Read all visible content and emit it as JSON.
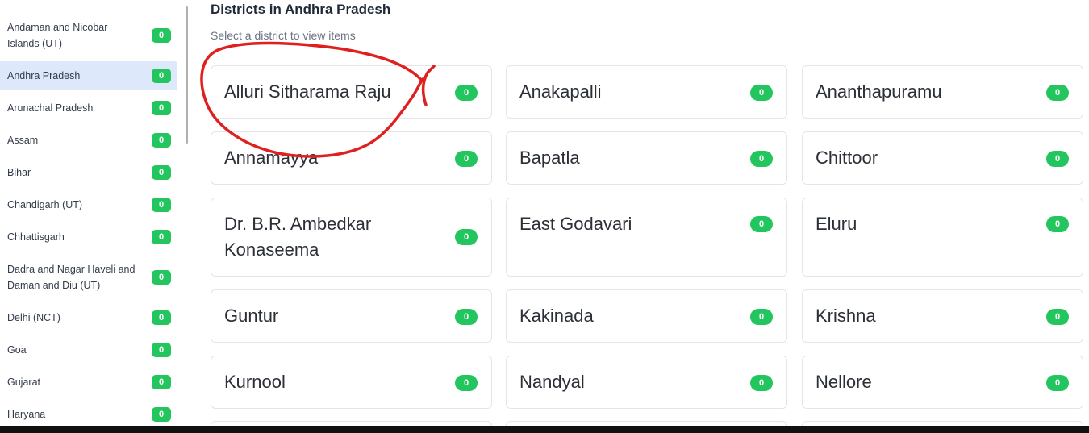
{
  "sidebar": {
    "states": [
      {
        "label": "Andaman and Nicobar Islands (UT)",
        "count": "0"
      },
      {
        "label": "Andhra Pradesh",
        "count": "0"
      },
      {
        "label": "Arunachal Pradesh",
        "count": "0"
      },
      {
        "label": "Assam",
        "count": "0"
      },
      {
        "label": "Bihar",
        "count": "0"
      },
      {
        "label": "Chandigarh (UT)",
        "count": "0"
      },
      {
        "label": "Chhattisgarh",
        "count": "0"
      },
      {
        "label": "Dadra and Nagar Haveli and Daman and Diu (UT)",
        "count": "0"
      },
      {
        "label": "Delhi (NCT)",
        "count": "0"
      },
      {
        "label": "Goa",
        "count": "0"
      },
      {
        "label": "Gujarat",
        "count": "0"
      },
      {
        "label": "Haryana",
        "count": "0"
      }
    ],
    "active_state": "Andhra Pradesh"
  },
  "main": {
    "title": "Districts in Andhra Pradesh",
    "subtitle": "Select a district to view items",
    "districts": [
      {
        "label": "Alluri Sitharama Raju",
        "count": "0"
      },
      {
        "label": "Anakapalli",
        "count": "0"
      },
      {
        "label": "Ananthapuramu",
        "count": "0"
      },
      {
        "label": "Annamayya",
        "count": "0"
      },
      {
        "label": "Bapatla",
        "count": "0"
      },
      {
        "label": "Chittoor",
        "count": "0"
      },
      {
        "label": "Dr. B.R. Ambedkar Konaseema",
        "count": "0"
      },
      {
        "label": "East Godavari",
        "count": "0"
      },
      {
        "label": "Eluru",
        "count": "0"
      },
      {
        "label": "Guntur",
        "count": "0"
      },
      {
        "label": "Kakinada",
        "count": "0"
      },
      {
        "label": "Krishna",
        "count": "0"
      },
      {
        "label": "Kurnool",
        "count": "0"
      },
      {
        "label": "Nandyal",
        "count": "0"
      },
      {
        "label": "Nellore",
        "count": "0"
      }
    ]
  },
  "colors": {
    "badge": "#22c55e",
    "active_item": "#dde9fb",
    "annotation": "#e01f1f"
  }
}
